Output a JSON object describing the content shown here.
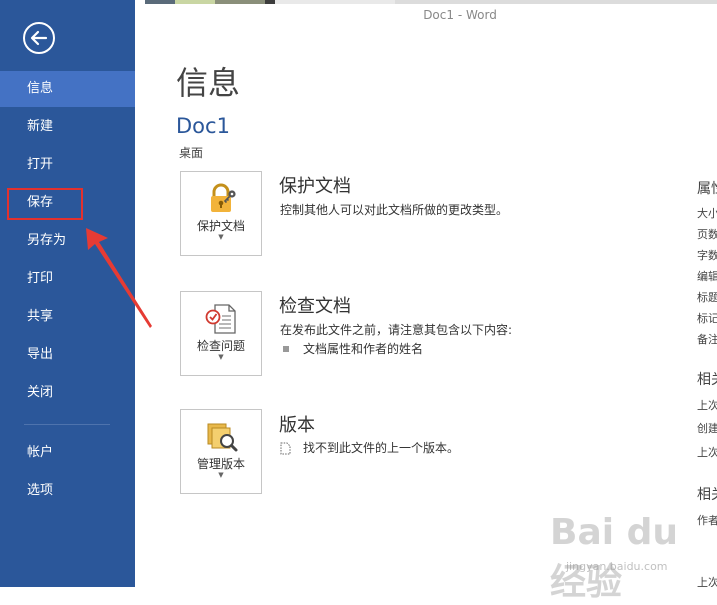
{
  "window": {
    "title": "Doc1 - Word"
  },
  "sidebar": {
    "items": [
      {
        "label": "信息"
      },
      {
        "label": "新建"
      },
      {
        "label": "打开"
      },
      {
        "label": "保存"
      },
      {
        "label": "另存为"
      },
      {
        "label": "打印"
      },
      {
        "label": "共享"
      },
      {
        "label": "导出"
      },
      {
        "label": "关闭"
      },
      {
        "label": "帐户"
      },
      {
        "label": "选项"
      }
    ],
    "active": "信息",
    "highlighted": "保存"
  },
  "main": {
    "title": "信息",
    "doc_name": "Doc1",
    "doc_location": "桌面",
    "sections": [
      {
        "button_label": "保护文档",
        "title": "保护文档",
        "description": "控制其他人可以对此文档所做的更改类型。",
        "icon": "lock-key-icon"
      },
      {
        "button_label": "检查问题",
        "title": "检查文档",
        "description": "在发布此文件之前，请注意其包含以下内容:",
        "bullet": "文档属性和作者的姓名",
        "icon": "inspect-document-icon"
      },
      {
        "button_label": "管理版本",
        "title": "版本",
        "description": "找不到此文件的上一个版本。",
        "icon": "manage-versions-icon"
      }
    ]
  },
  "properties": {
    "heading": "属性",
    "items": [
      "大小",
      "页数",
      "字数",
      "编辑",
      "标题",
      "标记",
      "备注"
    ],
    "related_dates_heading": "相关",
    "related_dates": [
      "上次",
      "创建",
      "上次"
    ],
    "related_people_heading": "相关",
    "related_people": [
      "作者"
    ],
    "last_item": "上次"
  },
  "watermark": {
    "text": "Bai du 经验",
    "sub": "jingyan.baidu.com"
  },
  "colors": {
    "sidebar": "#2b579a",
    "sidebar_active": "#4472c4",
    "accent": "#2b579a",
    "highlight": "#e3312d"
  }
}
